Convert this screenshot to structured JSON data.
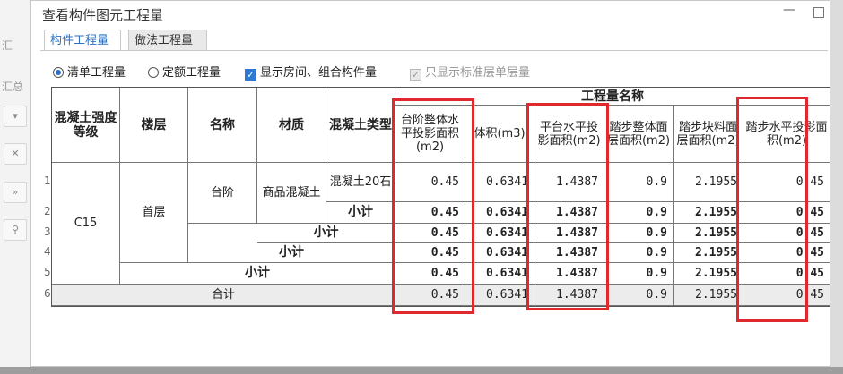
{
  "dialog": {
    "title": "查看构件图元工程量",
    "tabs": [
      "构件工程量",
      "做法工程量"
    ]
  },
  "background_panel": {
    "label_1": "汇",
    "label_2": "汇总"
  },
  "options": {
    "radio_list": "清单工程量",
    "radio_quota": "定额工程量",
    "show_room_combo": "显示房间、组合构件量",
    "only_standard_floor": "只显示标准层单层量"
  },
  "table": {
    "group_header": "工程量名称",
    "headers": {
      "grade": "混凝土强度等级",
      "floor": "楼层",
      "name": "名称",
      "material": "材质",
      "type": "混凝土类型",
      "q1": "台阶整体水平投影面积(m2)",
      "q2": "体积(m3)",
      "q3": "平台水平投影面积(m2)",
      "q4": "踏步整体面层面积(m2)",
      "q5": "踏步块料面层面积(m2)",
      "q6": "踏步水平投影面积(m2)"
    },
    "row_numbers": [
      "1",
      "2",
      "3",
      "4",
      "5",
      "6"
    ],
    "merged": {
      "grade": "C15",
      "floor": "首层",
      "name": "台阶",
      "material": "商品混凝土",
      "type": "混凝土20石"
    },
    "subtotal_label": "小计",
    "total_label": "合计",
    "rows": [
      {
        "values": [
          "0.45",
          "0.6341",
          "1.4387",
          "0.9",
          "2.1955",
          "0.45"
        ]
      },
      {
        "values": [
          "0.45",
          "0.6341",
          "1.4387",
          "0.9",
          "2.1955",
          "0.45"
        ]
      },
      {
        "values": [
          "0.45",
          "0.6341",
          "1.4387",
          "0.9",
          "2.1955",
          "0.45"
        ]
      },
      {
        "values": [
          "0.45",
          "0.6341",
          "1.4387",
          "0.9",
          "2.1955",
          "0.45"
        ]
      },
      {
        "values": [
          "0.45",
          "0.6341",
          "1.4387",
          "0.9",
          "2.1955",
          "0.45"
        ]
      },
      {
        "values": [
          "0.45",
          "0.6341",
          "1.4387",
          "0.9",
          "2.1955",
          "0.45"
        ]
      }
    ]
  },
  "colors": {
    "highlight": "#e0282f",
    "accent": "#2c6fc2"
  }
}
